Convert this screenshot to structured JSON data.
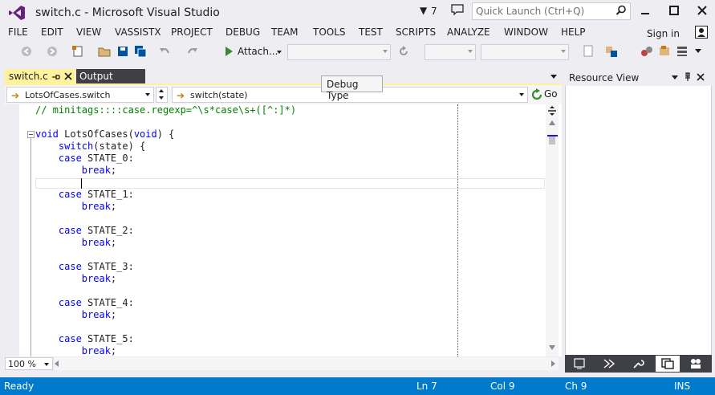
{
  "window": {
    "title": "switch.c - Microsoft Visual Studio",
    "notification_count": "7",
    "quick_launch_placeholder": "Quick Launch (Ctrl+Q)",
    "signin_label": "Sign in"
  },
  "menu": [
    "FILE",
    "EDIT",
    "VIEW",
    "VASSISTX",
    "PROJECT",
    "DEBUG",
    "TEAM",
    "TOOLS",
    "TEST",
    "SCRIPTS",
    "ANALYZE",
    "WINDOW",
    "HELP"
  ],
  "toolbar": {
    "attach_label": "Attach..."
  },
  "tabs": {
    "active": "switch.c",
    "other": "Output"
  },
  "tooltip": "Debug Type",
  "navbar": {
    "scope": "LotsOfCases.switch",
    "member": "switch(state)",
    "go_label": "Go"
  },
  "code_lines": [
    {
      "parts": [
        {
          "t": "// minitags::::case.regexp=^\\s*case\\s+([^:]*)",
          "c": "cm"
        }
      ]
    },
    {
      "parts": []
    },
    {
      "parts": [
        {
          "t": "void",
          "c": "kw"
        },
        {
          "t": " LotsOfCases(",
          "c": ""
        },
        {
          "t": "void",
          "c": "kw"
        },
        {
          "t": ") {",
          "c": ""
        }
      ]
    },
    {
      "parts": [
        {
          "t": "    ",
          "c": ""
        },
        {
          "t": "switch",
          "c": "kw"
        },
        {
          "t": "(state) {",
          "c": ""
        }
      ]
    },
    {
      "parts": [
        {
          "t": "    ",
          "c": ""
        },
        {
          "t": "case",
          "c": "kw"
        },
        {
          "t": " STATE_0:",
          "c": ""
        }
      ]
    },
    {
      "parts": [
        {
          "t": "        ",
          "c": ""
        },
        {
          "t": "break",
          "c": "kw"
        },
        {
          "t": ";",
          "c": ""
        }
      ]
    },
    {
      "parts": []
    },
    {
      "parts": [
        {
          "t": "    ",
          "c": ""
        },
        {
          "t": "case",
          "c": "kw"
        },
        {
          "t": " STATE_1:",
          "c": ""
        }
      ]
    },
    {
      "parts": [
        {
          "t": "        ",
          "c": ""
        },
        {
          "t": "break",
          "c": "kw"
        },
        {
          "t": ";",
          "c": ""
        }
      ]
    },
    {
      "parts": []
    },
    {
      "parts": [
        {
          "t": "    ",
          "c": ""
        },
        {
          "t": "case",
          "c": "kw"
        },
        {
          "t": " STATE_2:",
          "c": ""
        }
      ]
    },
    {
      "parts": [
        {
          "t": "        ",
          "c": ""
        },
        {
          "t": "break",
          "c": "kw"
        },
        {
          "t": ";",
          "c": ""
        }
      ]
    },
    {
      "parts": []
    },
    {
      "parts": [
        {
          "t": "    ",
          "c": ""
        },
        {
          "t": "case",
          "c": "kw"
        },
        {
          "t": " STATE_3:",
          "c": ""
        }
      ]
    },
    {
      "parts": [
        {
          "t": "        ",
          "c": ""
        },
        {
          "t": "break",
          "c": "kw"
        },
        {
          "t": ";",
          "c": ""
        }
      ]
    },
    {
      "parts": []
    },
    {
      "parts": [
        {
          "t": "    ",
          "c": ""
        },
        {
          "t": "case",
          "c": "kw"
        },
        {
          "t": " STATE_4:",
          "c": ""
        }
      ]
    },
    {
      "parts": [
        {
          "t": "        ",
          "c": ""
        },
        {
          "t": "break",
          "c": "kw"
        },
        {
          "t": ";",
          "c": ""
        }
      ]
    },
    {
      "parts": []
    },
    {
      "parts": [
        {
          "t": "    ",
          "c": ""
        },
        {
          "t": "case",
          "c": "kw"
        },
        {
          "t": " STATE_5:",
          "c": ""
        }
      ]
    },
    {
      "parts": [
        {
          "t": "        ",
          "c": ""
        },
        {
          "t": "break",
          "c": "kw"
        },
        {
          "t": ";",
          "c": ""
        }
      ]
    }
  ],
  "zoom": "100 %",
  "right_pane": {
    "title": "Resource View"
  },
  "status": {
    "state": "Ready",
    "line": "Ln 7",
    "col": "Col 9",
    "ch": "Ch 9",
    "mode": "INS"
  },
  "colors": {
    "accent": "#007acc",
    "active_tab": "#fff29d",
    "keyword": "#0000ff",
    "comment": "#008000",
    "vs_purple": "#68217a"
  }
}
